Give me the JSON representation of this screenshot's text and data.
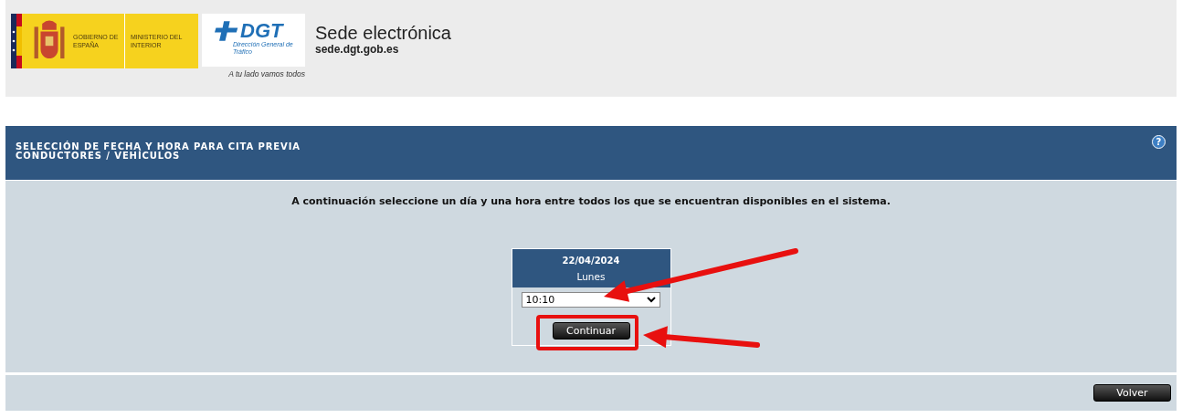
{
  "header": {
    "gov_logo": {
      "line_1": "GOBIERNO DE ESPAÑA",
      "line_2": "MINISTERIO DEL INTERIOR"
    },
    "dgt_logo": {
      "name": "DGT",
      "subtitle": "Dirección General de Tráfico",
      "slogan": "A tu lado vamos todos"
    },
    "site_title": "Sede electrónica",
    "site_url": "sede.dgt.gob.es"
  },
  "panel": {
    "help": "?",
    "title_lines": [
      "SELECCIÓN DE FECHA Y HORA PARA CITA PREVIA",
      "CONDUCTORES / VEHÍCULOS"
    ],
    "instruction": "A continuación seleccione un día y una hora entre todos los que se encuentran disponibles en el sistema.",
    "slot": {
      "date": "22/04/2024",
      "weekday": "Lunes",
      "time": "10:10",
      "button": "Continuar"
    }
  },
  "footer": {
    "button": "Volver"
  },
  "annotations": [
    {
      "kind": "arrow"
    },
    {
      "kind": "arrow"
    },
    {
      "kind": "frame"
    }
  ]
}
